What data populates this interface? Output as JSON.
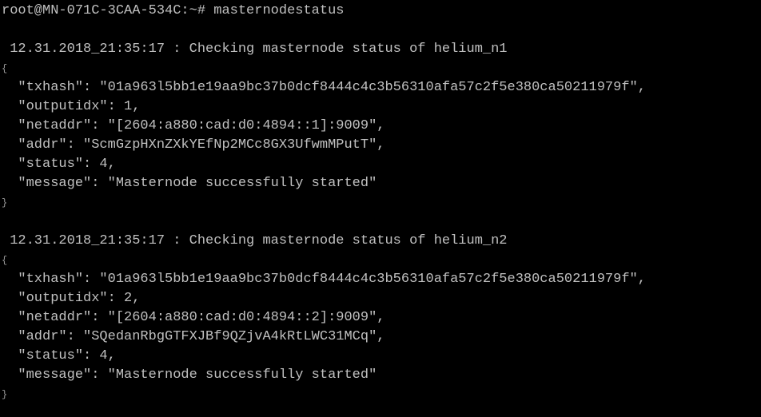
{
  "terminal": {
    "prompt": "root@MN-071C-3CAA-534C:~#",
    "command": "masternodestatus",
    "text_color": "#c0c0c0",
    "background_color": "#000000"
  },
  "blocks": [
    {
      "header": " 12.31.2018_21:35:17 : Checking masternode status of helium_n1",
      "open": "{",
      "fields": [
        "  \"txhash\": \"01a963l5bb1e19aa9bc37b0dcf8444c4c3b56310afa57c2f5e380ca50211979f\",",
        "  \"outputidx\": 1,",
        "  \"netaddr\": \"[2604:a880:cad:d0:4894::1]:9009\",",
        "  \"addr\": \"ScmGzpHXnZXkYEfNp2MCc8GX3UfwmMPutT\",",
        "  \"status\": 4,",
        "  \"message\": \"Masternode successfully started\""
      ],
      "close": "}"
    },
    {
      "header": " 12.31.2018_21:35:17 : Checking masternode status of helium_n2",
      "open": "{",
      "fields": [
        "  \"txhash\": \"01a963l5bb1e19aa9bc37b0dcf8444c4c3b56310afa57c2f5e380ca50211979f\",",
        "  \"outputidx\": 2,",
        "  \"netaddr\": \"[2604:a880:cad:d0:4894::2]:9009\",",
        "  \"addr\": \"SQedanRbgGTFXJBf9QZjvA4kRtLWC31MCq\",",
        "  \"status\": 4,",
        "  \"message\": \"Masternode successfully started\""
      ],
      "close": "}"
    }
  ]
}
